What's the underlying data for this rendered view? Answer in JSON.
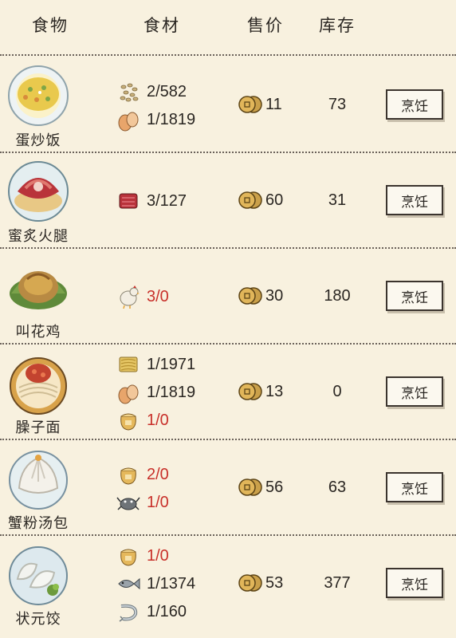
{
  "header": {
    "col_food": "食物",
    "col_ingredients": "食材",
    "col_price": "售价",
    "col_stock": "库存"
  },
  "accent_red": "#c8302a",
  "coin_color": "#d7a43a",
  "rows": [
    {
      "name": "蛋炒饭",
      "dish_icon": "fried-rice",
      "ingredients": [
        {
          "icon": "rice-grain",
          "amount": "2/582",
          "short": false
        },
        {
          "icon": "egg",
          "amount": "1/1819",
          "short": false
        }
      ],
      "price": "11",
      "stock": "73",
      "button": "烹饪"
    },
    {
      "name": "蜜炙火腿",
      "dish_icon": "honey-ham",
      "ingredients": [
        {
          "icon": "ham",
          "amount": "3/127",
          "short": false
        }
      ],
      "price": "60",
      "stock": "31",
      "button": "烹饪"
    },
    {
      "name": "叫花鸡",
      "dish_icon": "beggar-chicken",
      "ingredients": [
        {
          "icon": "chicken",
          "amount": "3/0",
          "short": true
        }
      ],
      "price": "30",
      "stock": "180",
      "button": "烹饪"
    },
    {
      "name": "臊子面",
      "dish_icon": "noodle-bowl",
      "ingredients": [
        {
          "icon": "noodles",
          "amount": "1/1971",
          "short": false
        },
        {
          "icon": "egg",
          "amount": "1/1819",
          "short": false
        },
        {
          "icon": "flour-sack",
          "amount": "1/0",
          "short": true
        }
      ],
      "price": "13",
      "stock": "0",
      "button": "烹饪"
    },
    {
      "name": "蟹粉汤包",
      "dish_icon": "soup-dumpling",
      "ingredients": [
        {
          "icon": "flour-sack",
          "amount": "2/0",
          "short": true
        },
        {
          "icon": "crab",
          "amount": "1/0",
          "short": true
        }
      ],
      "price": "56",
      "stock": "63",
      "button": "烹饪"
    },
    {
      "name": "状元饺",
      "dish_icon": "dumplings",
      "ingredients": [
        {
          "icon": "flour-sack",
          "amount": "1/0",
          "short": true
        },
        {
          "icon": "fish",
          "amount": "1/1374",
          "short": false
        },
        {
          "icon": "shrimp",
          "amount": "1/160",
          "short": false
        }
      ],
      "price": "53",
      "stock": "377",
      "button": "烹饪"
    }
  ]
}
